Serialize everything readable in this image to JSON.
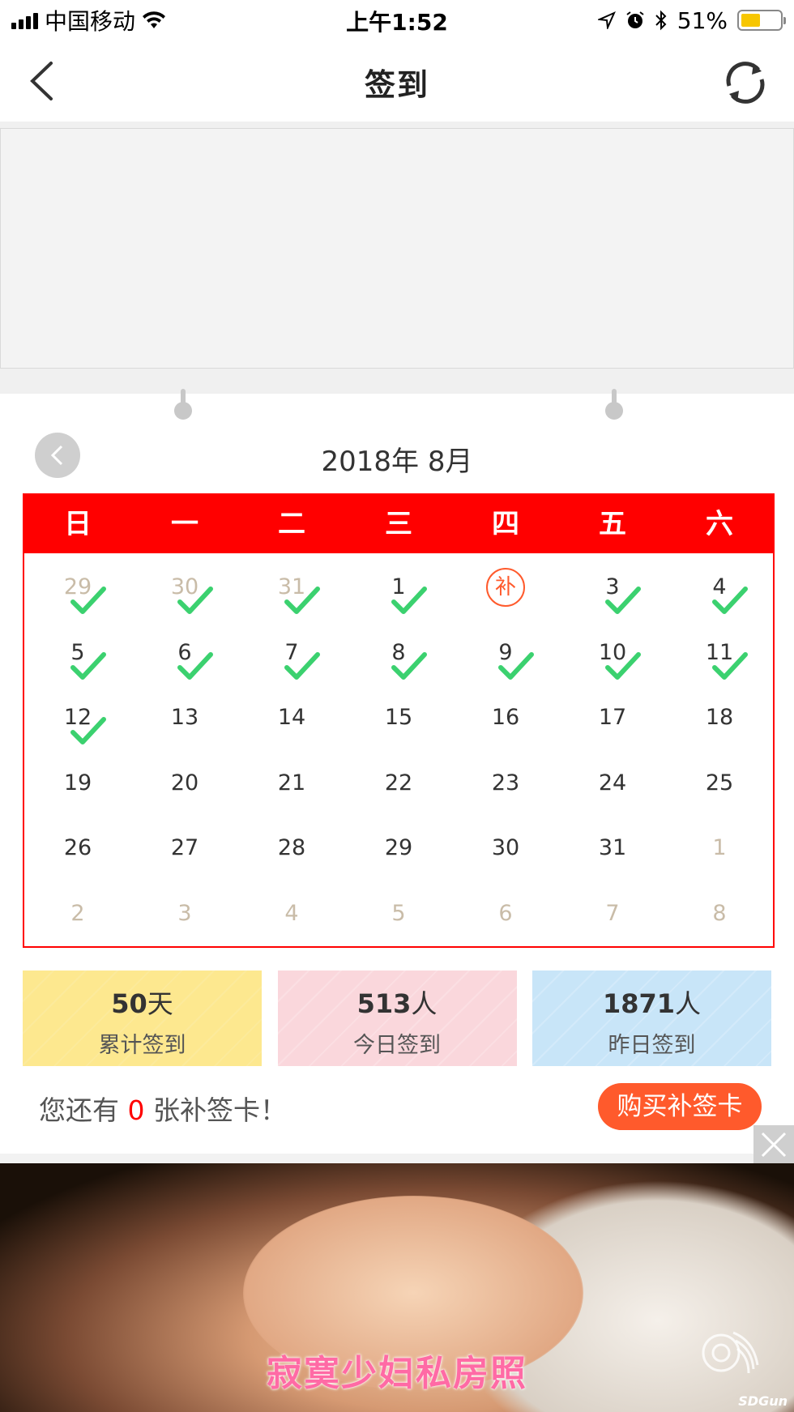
{
  "status_bar": {
    "carrier": "中国移动",
    "time": "上午1:52",
    "battery_text": "51%",
    "battery_level": 0.51,
    "icons": [
      "signal-icon",
      "wifi-icon",
      "location-icon",
      "alarm-icon",
      "bluetooth-icon",
      "battery-icon"
    ]
  },
  "nav": {
    "title": "签到",
    "back_icon": "chevron-left-icon",
    "refresh_icon": "refresh-icon"
  },
  "calendar": {
    "month_title": "2018年 8月",
    "weekdays": [
      "日",
      "一",
      "二",
      "三",
      "四",
      "五",
      "六"
    ],
    "makeup_label": "补",
    "rows": [
      [
        {
          "d": "29",
          "other": true,
          "checked": true
        },
        {
          "d": "30",
          "other": true,
          "checked": true
        },
        {
          "d": "31",
          "other": true,
          "checked": true
        },
        {
          "d": "1",
          "checked": true
        },
        {
          "d": "",
          "makeup": true
        },
        {
          "d": "3",
          "checked": true
        },
        {
          "d": "4",
          "checked": true
        }
      ],
      [
        {
          "d": "5",
          "checked": true
        },
        {
          "d": "6",
          "checked": true
        },
        {
          "d": "7",
          "checked": true
        },
        {
          "d": "8",
          "checked": true
        },
        {
          "d": "9",
          "checked": true
        },
        {
          "d": "10",
          "checked": true
        },
        {
          "d": "11",
          "checked": true
        }
      ],
      [
        {
          "d": "12",
          "checked": true
        },
        {
          "d": "13"
        },
        {
          "d": "14"
        },
        {
          "d": "15"
        },
        {
          "d": "16"
        },
        {
          "d": "17"
        },
        {
          "d": "18"
        }
      ],
      [
        {
          "d": "19"
        },
        {
          "d": "20"
        },
        {
          "d": "21"
        },
        {
          "d": "22"
        },
        {
          "d": "23"
        },
        {
          "d": "24"
        },
        {
          "d": "25"
        }
      ],
      [
        {
          "d": "26"
        },
        {
          "d": "27"
        },
        {
          "d": "28"
        },
        {
          "d": "29"
        },
        {
          "d": "30"
        },
        {
          "d": "31"
        },
        {
          "d": "1",
          "other": true
        }
      ],
      [
        {
          "d": "2",
          "other": true
        },
        {
          "d": "3",
          "other": true
        },
        {
          "d": "4",
          "other": true
        },
        {
          "d": "5",
          "other": true
        },
        {
          "d": "6",
          "other": true
        },
        {
          "d": "7",
          "other": true
        },
        {
          "d": "8",
          "other": true
        }
      ]
    ]
  },
  "stats": [
    {
      "value": "50",
      "unit": "天",
      "label": "累计签到"
    },
    {
      "value": "513",
      "unit": "人",
      "label": "今日签到"
    },
    {
      "value": "1871",
      "unit": "人",
      "label": "昨日签到"
    }
  ],
  "makeup_card": {
    "prefix": "您还有",
    "count": "0",
    "suffix": "张补签卡！",
    "buy_label": "购买补签卡"
  },
  "ad": {
    "caption": "寂寞少妇私房照",
    "watermark": "SDGun"
  },
  "colors": {
    "accent_red": "#ff0000",
    "check_green": "#3bd16f",
    "button_orange": "#ff5a2c",
    "stat_yellow": "#fde88f",
    "stat_pink": "#fad7dc",
    "stat_blue": "#c8e5f8"
  }
}
